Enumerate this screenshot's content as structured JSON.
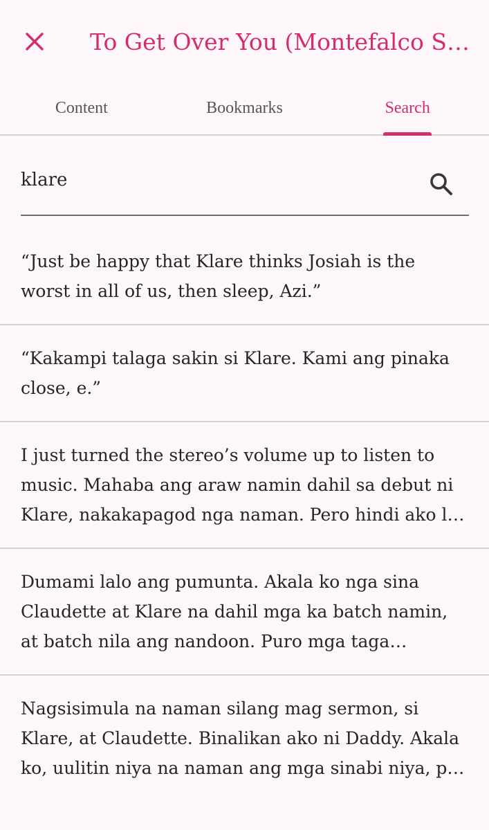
{
  "app_bar": {
    "close_icon": "close-icon",
    "title": "To Get Over You (Montefalco Ser…"
  },
  "tabs": [
    {
      "label": "Content",
      "active": false
    },
    {
      "label": "Bookmarks",
      "active": false
    },
    {
      "label": "Search",
      "active": true
    }
  ],
  "search": {
    "value": "klare",
    "icon": "search-icon"
  },
  "results": [
    {
      "text": "“Just be happy that Klare thinks Josiah is the worst in all of us, then sleep, Azi.”"
    },
    {
      "text": "“Kakampi talaga sakin si Klare. Kami ang pinaka close, e.”"
    },
    {
      "text": "I just turned the stereo’s volume up to listen to music. Mahaba ang araw namin dahil sa debut ni Klare, nakakapagod nga naman. Pero hindi ako l…"
    },
    {
      "text": "Dumami lalo ang pumunta. Akala ko nga sina Claudette at Klare na dahil mga ka batch namin, at batch nila ang nandoon. Puro mga taga Xavier…"
    },
    {
      "text": "Nagsisimula na naman silang mag sermon, si Klare, at Claudette. Binalikan ako ni Daddy. Akala ko, uulitin niya na naman ang mga sinabi niya, p…"
    }
  ],
  "colors": {
    "accent": "#d22f6a",
    "background": "#fdf6fb",
    "divider": "#d6d0d3"
  }
}
